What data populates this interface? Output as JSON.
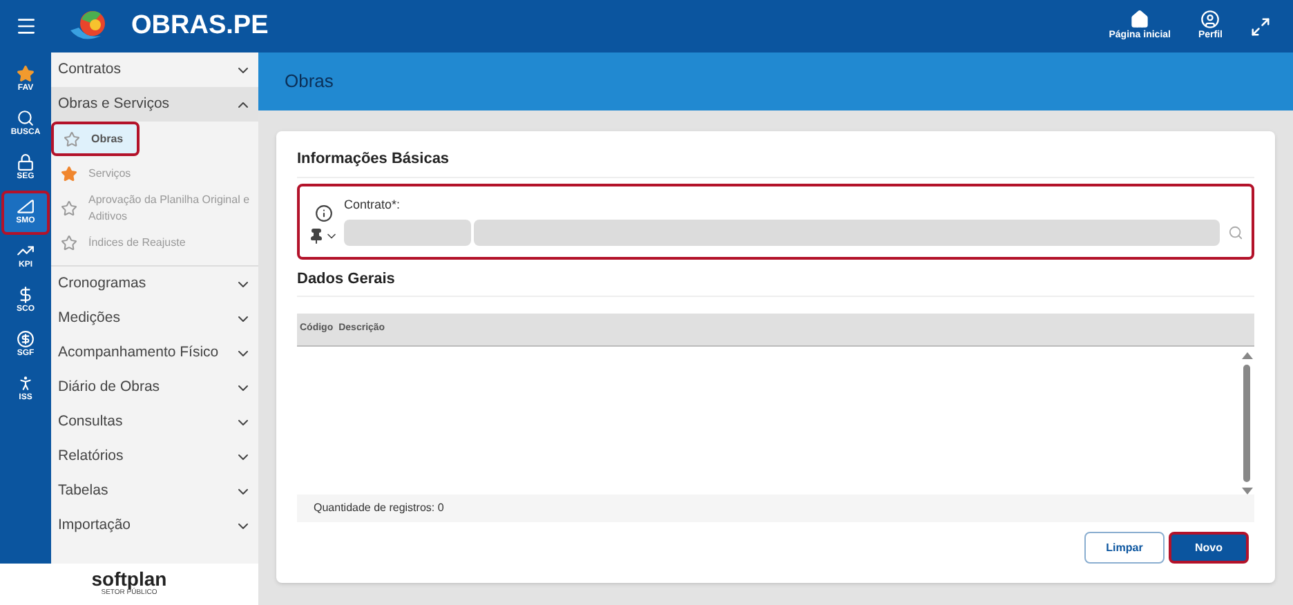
{
  "app": {
    "title": "OBRAS.PE"
  },
  "header_actions": [
    {
      "kind": "home",
      "label": "Página inicial"
    },
    {
      "kind": "profile",
      "label": "Perfil"
    },
    {
      "kind": "expand"
    }
  ],
  "rail": [
    {
      "kind": "star",
      "label": "FAV",
      "selected": false,
      "highlighted": false
    },
    {
      "kind": "search",
      "label": "BUSCA",
      "selected": false,
      "highlighted": false
    },
    {
      "kind": "lock",
      "label": "SEG",
      "selected": false,
      "highlighted": false
    },
    {
      "kind": "ruler",
      "label": "SMO",
      "selected": true,
      "highlighted": true
    },
    {
      "kind": "chart",
      "label": "KPI",
      "selected": false,
      "highlighted": false
    },
    {
      "kind": "money",
      "label": "SCO",
      "selected": false,
      "highlighted": false
    },
    {
      "kind": "coin",
      "label": "SGF",
      "selected": false,
      "highlighted": false
    },
    {
      "kind": "person",
      "label": "ISS",
      "selected": false,
      "highlighted": false
    }
  ],
  "menu": [
    {
      "label": "Contratos",
      "expanded": false
    },
    {
      "label": "Obras e Serviços",
      "expanded": true,
      "children": [
        {
          "label": "Obras",
          "selected": true,
          "favorite": false,
          "highlighted": true
        },
        {
          "label": "Serviços",
          "selected": false,
          "favorite": true,
          "highlighted": false
        },
        {
          "label": "Aprovação da Planilha Original e Aditivos",
          "selected": false,
          "favorite": false,
          "highlighted": false
        },
        {
          "label": "Índices de Reajuste",
          "selected": false,
          "favorite": false,
          "highlighted": false
        }
      ]
    },
    {
      "label": "Cronogramas",
      "expanded": false
    },
    {
      "label": "Medições",
      "expanded": false
    },
    {
      "label": "Acompanhamento Físico",
      "expanded": false
    },
    {
      "label": "Diário de Obras",
      "expanded": false
    },
    {
      "label": "Consultas",
      "expanded": false
    },
    {
      "label": "Relatórios",
      "expanded": false
    },
    {
      "label": "Tabelas",
      "expanded": false
    },
    {
      "label": "Importação",
      "expanded": false
    }
  ],
  "footer_logo": {
    "name": "softplan",
    "subtitle": "SETOR PÚBLICO"
  },
  "page": {
    "title": "Obras"
  },
  "basic_info": {
    "title": "Informações Básicas",
    "highlighted": true,
    "contract_label": "Contrato*:"
  },
  "general": {
    "title": "Dados Gerais",
    "columns": [
      "Código",
      "Descrição"
    ],
    "record_count": "Quantidade de registros: 0"
  },
  "buttons": [
    {
      "label": "Limpar",
      "kind": "secondary",
      "highlighted": false
    },
    {
      "label": "Novo",
      "kind": "primary",
      "highlighted": true
    }
  ]
}
